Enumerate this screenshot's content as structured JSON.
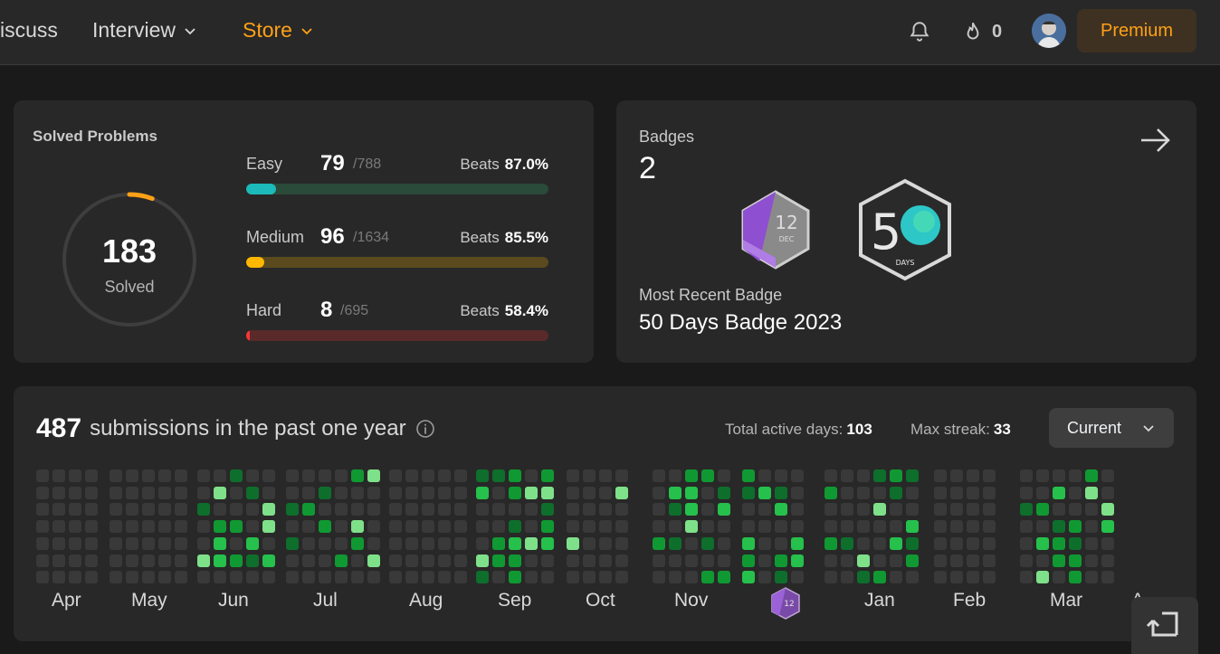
{
  "nav": {
    "items": [
      {
        "label": "iscuss"
      },
      {
        "label": "Interview"
      },
      {
        "label": "Store"
      }
    ],
    "streak_count": "0",
    "premium_label": "Premium"
  },
  "solved": {
    "title": "Solved Problems",
    "total": "183",
    "total_label": "Solved",
    "difficulties": [
      {
        "name": "Easy",
        "count": "79",
        "total": "/788",
        "beats_label": "Beats",
        "beats": "87.0%",
        "fill": 0.1,
        "color": "#1cbaba",
        "track": "#2a4a3a"
      },
      {
        "name": "Medium",
        "count": "96",
        "total": "/1634",
        "beats_label": "Beats",
        "beats": "85.5%",
        "fill": 0.059,
        "color": "#ffb700",
        "track": "#5a4a1e"
      },
      {
        "name": "Hard",
        "count": "8",
        "total": "/695",
        "beats_label": "Beats",
        "beats": "58.4%",
        "fill": 0.012,
        "color": "#f63737",
        "track": "#5a2a2a"
      }
    ],
    "ring_fill": 0.057,
    "ring_color": "#ffa116"
  },
  "badges": {
    "label": "Badges",
    "count": "2",
    "recent_label": "Most Recent Badge",
    "recent_name": "50 Days Badge 2023",
    "badge1_text": "12",
    "badge1_sub": "DEC",
    "badge2_num": "5",
    "badge2_sub": "DAYS"
  },
  "submissions": {
    "count": "487",
    "text": "submissions in the past one year",
    "active_label": "Total active days:",
    "active_value": "103",
    "streak_label": "Max streak:",
    "streak_value": "33",
    "dropdown": "Current",
    "months": [
      "Apr",
      "May",
      "Jun",
      "Jul",
      "Aug",
      "Sep",
      "Oct",
      "Nov",
      "Jan",
      "Feb",
      "Mar",
      "A"
    ],
    "small_badge_text": "12",
    "colors": {
      "empty": "#393939",
      "l1": "#0e6e2c",
      "l2": "#109932",
      "l3": "#26c04c",
      "l4": "#7fe08a"
    }
  }
}
